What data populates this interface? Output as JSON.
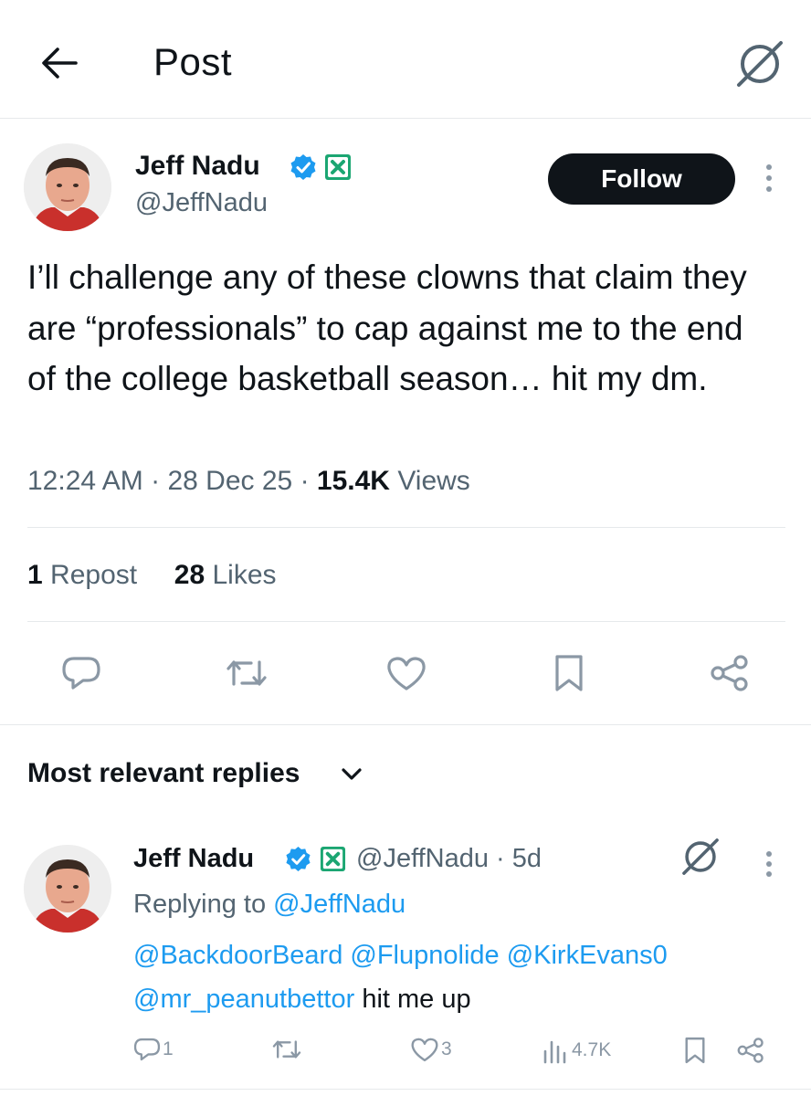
{
  "header": {
    "title": "Post"
  },
  "post": {
    "author_name": "Jeff Nadu",
    "handle": "@JeffNadu",
    "follow_label": "Follow",
    "text": "I’ll challenge any of these clowns that claim they are “professionals” to cap against me to the end of the college basketball season… hit my dm.",
    "time": "12:24 AM",
    "date": "28 Dec 25",
    "sep": "·",
    "views_count": "15.4K",
    "views_label": "Views",
    "reposts_count": "1",
    "reposts_label": "Repost",
    "likes_count": "28",
    "likes_label": "Likes"
  },
  "replies_section": {
    "sort_label": "Most relevant replies"
  },
  "reply": {
    "author_name": "Jeff Nadu",
    "handle_time": "@JeffNadu · 5d",
    "replying_prefix": "Replying to",
    "replying_to": "@JeffNadu",
    "mentions_line1": "@BackdoorBeard @Flupnolide @KirkEvans0",
    "mention_line2": "@mr_peanutbettor",
    "text_tail": "hit me up",
    "reply_count": "1",
    "like_count": "3",
    "view_count": "4.7K"
  },
  "colors": {
    "accent": "#1d9bf0",
    "affiliate_badge": "#1ba672",
    "text": "#0f1419",
    "muted": "#536471"
  },
  "icons": [
    "back-arrow-icon",
    "grok-icon",
    "verified-badge-icon",
    "affiliate-badge-icon",
    "more-vertical-icon",
    "reply-icon",
    "repost-icon",
    "like-icon",
    "bookmark-icon",
    "share-icon",
    "chevron-down-icon",
    "views-icon"
  ]
}
